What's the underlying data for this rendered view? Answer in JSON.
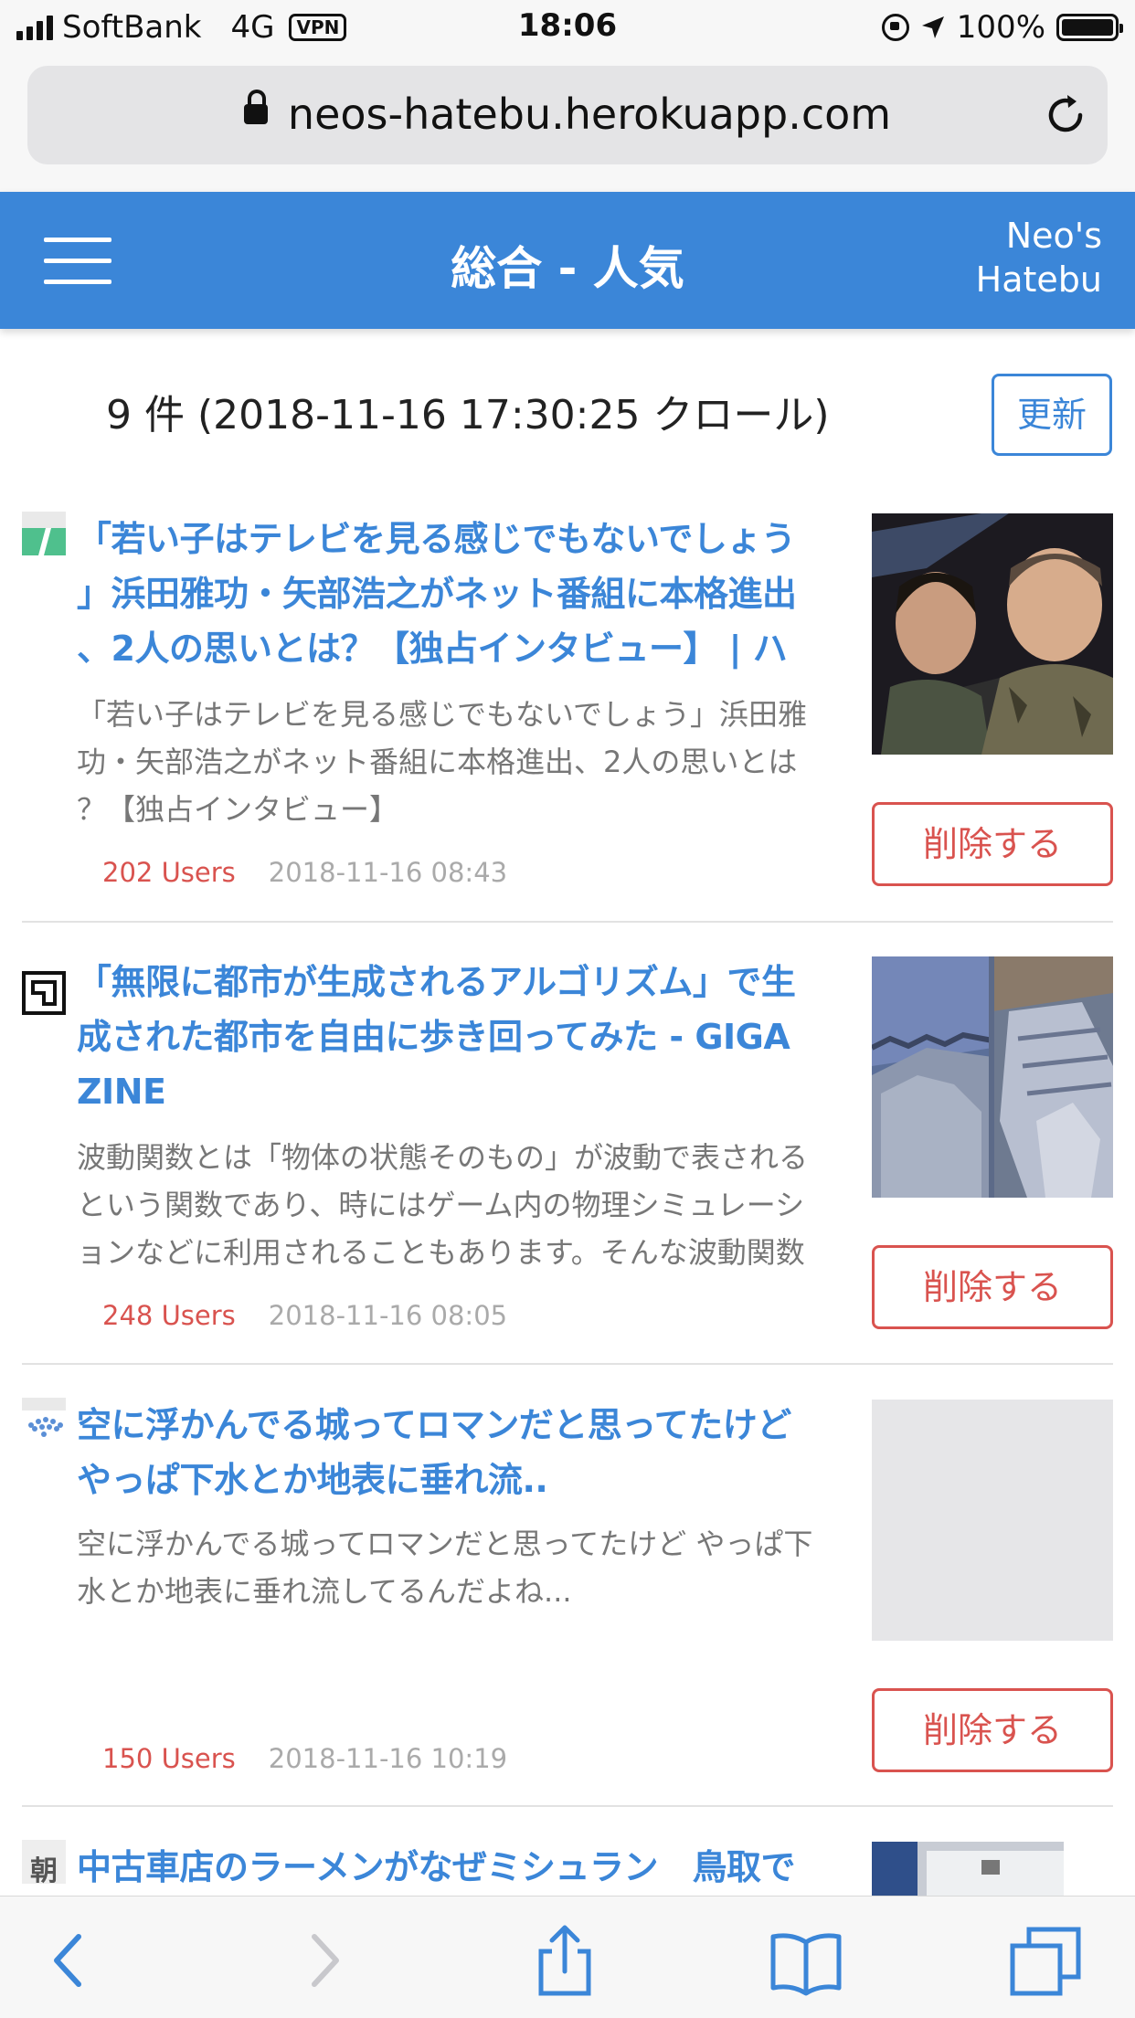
{
  "status_bar": {
    "carrier": "SoftBank",
    "network": "4G",
    "vpn": "VPN",
    "time": "18:06",
    "battery": "100%",
    "battery_level": 1.0
  },
  "browser": {
    "url": "neos-hatebu.herokuapp.com"
  },
  "header": {
    "title": "総合 - 人気",
    "brand_line1": "Neo's",
    "brand_line2": "Hatebu"
  },
  "summary": {
    "count_text": "9 件 (2018-11-16 17:30:25 クロール)",
    "refresh_label": "更新"
  },
  "articles": [
    {
      "title_lines": [
        "「若い子はテレビを見る感じでもないでしょう",
        "」浜田雅功・矢部浩之がネット番組に本格進出",
        "、2人の思いとは？【独占インタビュー】 | ハ"
      ],
      "desc_lines": [
        "「若い子はテレビを見る感じでもないでしょう」浜田雅",
        "功・矢部浩之がネット番組に本格進出、2人の思いとは",
        "？【独占インタビュー】"
      ],
      "users": "202 Users",
      "date": "2018-11-16 08:43",
      "delete_label": "削除する"
    },
    {
      "title_lines": [
        "「無限に都市が生成されるアルゴリズム」で生",
        "成された都市を自由に歩き回ってみた - GIGA",
        "ZINE"
      ],
      "desc_lines": [
        "波動関数とは「物体の状態そのもの」が波動で表される",
        "という関数であり、時にはゲーム内の物理シミュレーシ",
        "ョンなどに利用されることもあります。そんな波動関数"
      ],
      "users": "248 Users",
      "date": "2018-11-16 08:05",
      "delete_label": "削除する"
    },
    {
      "title_lines": [
        "空に浮かんでる城ってロマンだと思ってたけど",
        "やっぱ下水とか地表に垂れ流.."
      ],
      "desc_lines": [
        "空に浮かんでる城ってロマンだと思ってたけど やっぱ下",
        "水とか地表に垂れ流してるんだよね..."
      ],
      "users": "150 Users",
      "date": "2018-11-16 10:19",
      "delete_label": "削除する"
    },
    {
      "title_lines": [
        "中古車店のラーメンがなぜミシュラン　鳥取で"
      ],
      "favicon_text": "朝"
    }
  ],
  "colors": {
    "accent": "#3b86d8",
    "danger": "#d9534f",
    "muted": "#777777"
  },
  "icons": {
    "toolbar": [
      "back-icon",
      "forward-icon",
      "share-icon",
      "bookmarks-icon",
      "tabs-icon"
    ]
  }
}
